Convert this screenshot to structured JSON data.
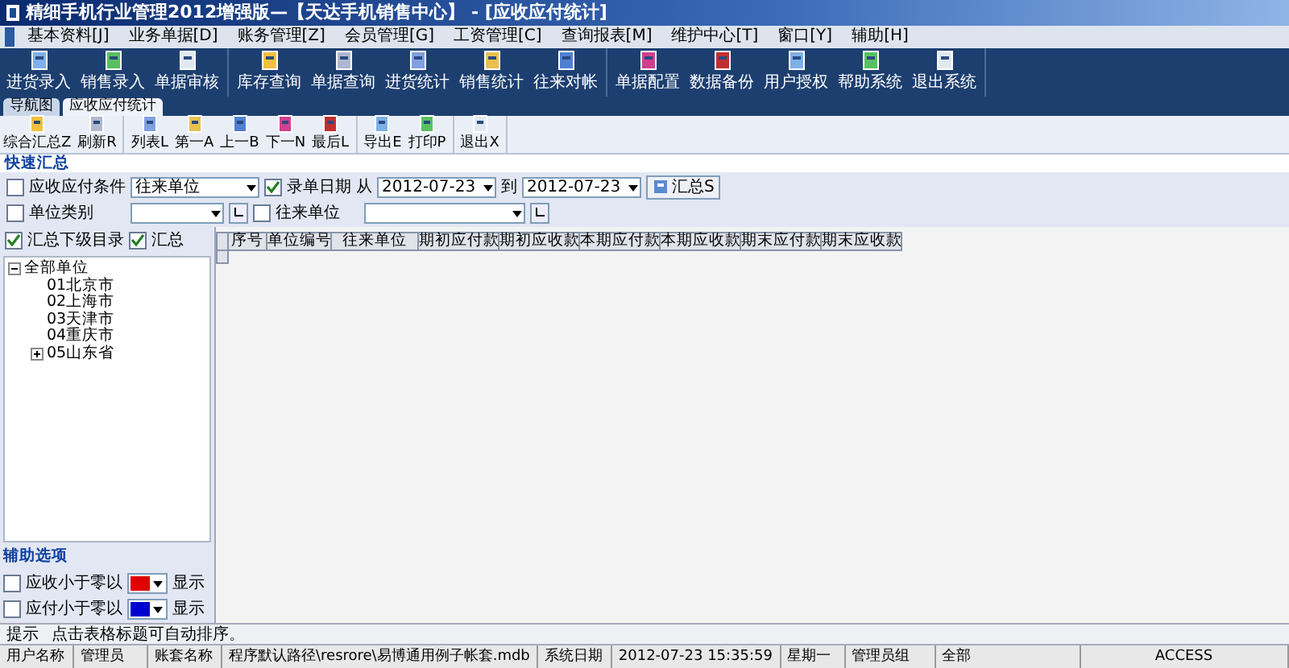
{
  "window": {
    "title": "精细手机行业管理2012增强版—【天达手机销售中心】 - [应收应付统计]"
  },
  "menu": [
    "基本资料[J]",
    "业务单据[D]",
    "账务管理[Z]",
    "会员管理[G]",
    "工资管理[C]",
    "查询报表[M]",
    "维护中心[T]",
    "窗口[Y]",
    "辅助[H]"
  ],
  "toolbar": [
    [
      "进货录入",
      "销售录入",
      "单据审核"
    ],
    [
      "库存查询",
      "单据查询",
      "进货统计",
      "销售统计",
      "往来对帐"
    ],
    [
      "单据配置",
      "数据备份",
      "用户授权",
      "帮助系统",
      "退出系统"
    ]
  ],
  "tabs": [
    {
      "label": "导航图",
      "selected": false
    },
    {
      "label": "应收应付统计",
      "selected": true
    }
  ],
  "toolbar2": [
    [
      "综合汇总Z",
      "刷新R"
    ],
    [
      "列表L",
      "第一A",
      "上一B",
      "下一N",
      "最后L"
    ],
    [
      "导出E",
      "打印P"
    ],
    [
      "退出X"
    ]
  ],
  "section_title": "快速汇总",
  "filters": {
    "condition": {
      "label": "应收应付条件",
      "checked": false,
      "value": "往来单位"
    },
    "date": {
      "label": "录单日期",
      "checked": true,
      "from_label": "从",
      "from": "2012-07-23",
      "to_label": "到",
      "to": "2012-07-23"
    },
    "summary_button": "汇总S",
    "unit_type": {
      "label": "单位类别",
      "checked": false
    },
    "partner": {
      "label": "往来单位",
      "checked": false
    }
  },
  "options": [
    {
      "label": "汇总下级目录",
      "checked": true
    },
    {
      "label": "汇总",
      "checked": true
    }
  ],
  "tree": {
    "label": "全部单位",
    "expanded": true,
    "children": [
      {
        "label": "01北京市"
      },
      {
        "label": "02上海市"
      },
      {
        "label": "03天津市"
      },
      {
        "label": "04重庆市"
      },
      {
        "label": "05山东省",
        "expanded": false
      }
    ]
  },
  "aux": {
    "title": "辅助选项",
    "rows": [
      {
        "label": "应收小于零以",
        "checked": false,
        "color": "#e00000",
        "suffix": "显示"
      },
      {
        "label": "应付小于零以",
        "checked": false,
        "color": "#0000d0",
        "suffix": "显示"
      }
    ]
  },
  "table": {
    "columns": [
      "序号",
      "单位编号",
      "往来单位",
      "期初应付款",
      "期初应收款",
      "本期应付款",
      "本期应收款",
      "期末应付款",
      "期末应收款"
    ]
  },
  "hint": {
    "label": "提示",
    "text": "点击表格标题可自动排序。"
  },
  "status_bar": [
    "用户名称",
    "管理员",
    "账套名称",
    "程序默认路径\\resrore\\易博通用例子帐套.mdb",
    "系统日期",
    "2012-07-23  15:35:59",
    "星期一",
    "管理员组",
    "全部",
    "ACCESS"
  ]
}
